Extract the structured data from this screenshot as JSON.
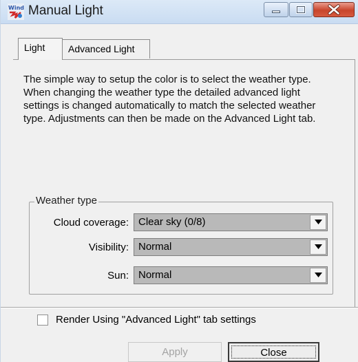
{
  "window": {
    "title": "Manual Light",
    "app_icon": "wind-app-icon",
    "caption_buttons": [
      "minimize-icon",
      "maximize-icon",
      "close-icon"
    ]
  },
  "tabs": [
    {
      "label": "Light",
      "active": true
    },
    {
      "label": "Advanced Light",
      "active": false
    }
  ],
  "light_tab": {
    "description": "The simple way to setup the color is to select the weather type. When changing the weather type the detailed advanced light settings is changed automatically to match the selected weather type. Adjustments can then be made on the Advanced Light tab.",
    "weather_group": {
      "title": "Weather type",
      "fields": {
        "cloud_label": "Cloud coverage:",
        "cloud_value": "Clear sky (0/8)",
        "visibility_label": "Visibility:",
        "visibility_value": "Normal",
        "sun_label": "Sun:",
        "sun_value": "Normal"
      }
    }
  },
  "render_option": {
    "label": "Render Using \"Advanced Light\" tab settings",
    "checked": false
  },
  "buttons": {
    "apply_label": "Apply",
    "apply_enabled": false,
    "close_label": "Close"
  },
  "colors": {
    "titlebar": "#c9dcf2",
    "close_button": "#c8452c",
    "combo_background": "#b9b9b9",
    "dialog_background": "#f0f0f0"
  }
}
